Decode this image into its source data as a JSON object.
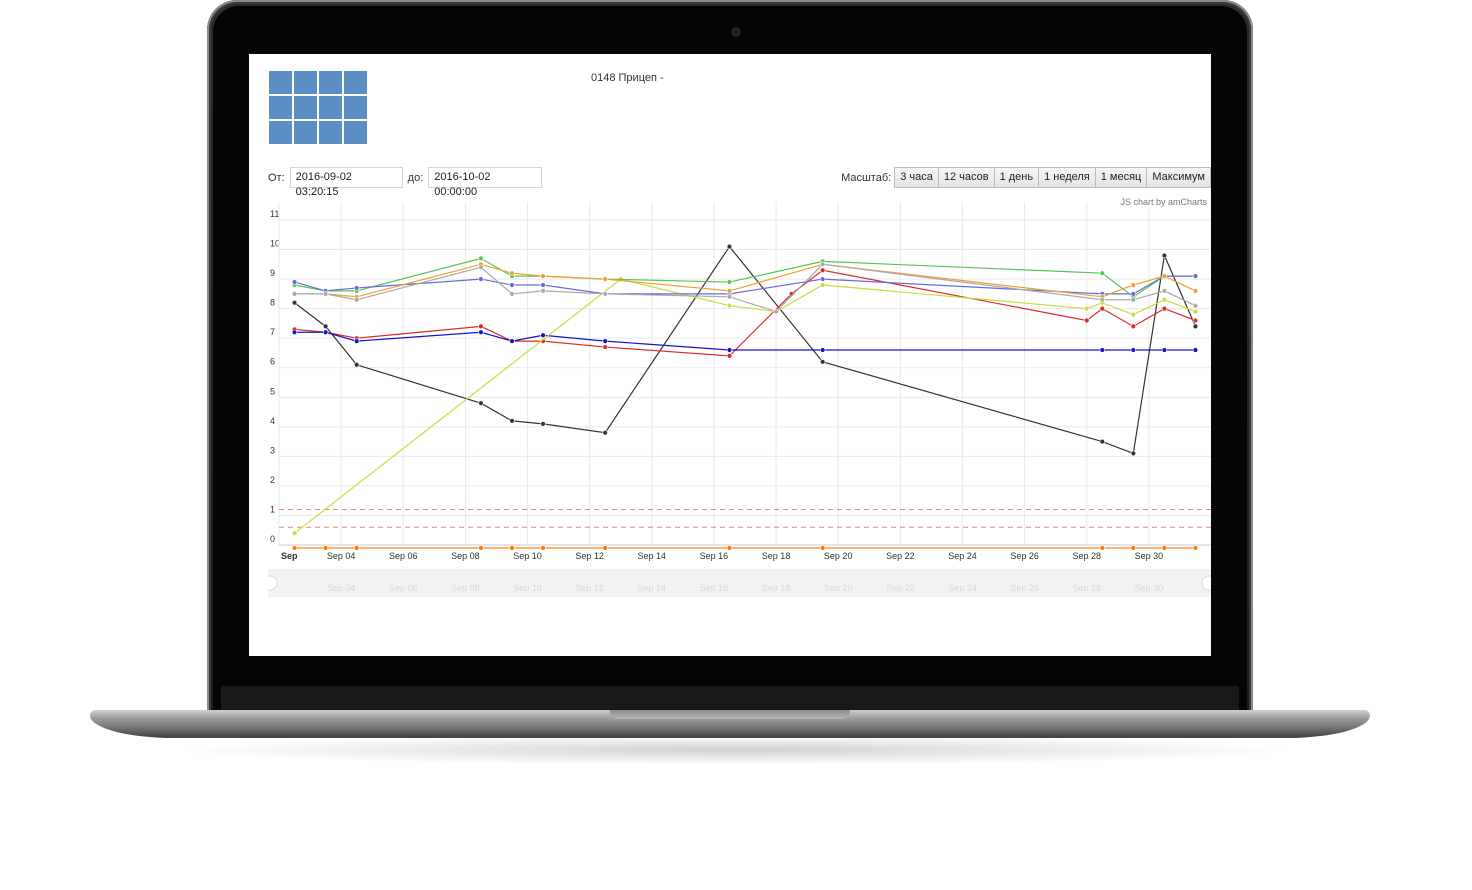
{
  "header": {
    "vehicle_title": "0148 Прицеп -"
  },
  "range": {
    "from_label": "От:",
    "from_value": "2016-09-02 03:20:15",
    "to_label": "до:",
    "to_value": "2016-10-02 00:00:00"
  },
  "scale": {
    "label": "Масштаб:",
    "buttons": [
      "3 часа",
      "12 часов",
      "1 день",
      "1 неделя",
      "1 месяц",
      "Максимум"
    ]
  },
  "credits": "JS chart by amCharts",
  "chart_data": {
    "type": "line",
    "title": "",
    "xlabel": "",
    "ylabel": "",
    "ylim": [
      0,
      11
    ],
    "xlim": [
      "2016-09-02",
      "2016-10-02"
    ],
    "grid": true,
    "legend": "none",
    "x_ticks": [
      "Sep",
      "Sep 04",
      "Sep 06",
      "Sep 08",
      "Sep 10",
      "Sep 12",
      "Sep 14",
      "Sep 16",
      "Sep 18",
      "Sep 20",
      "Sep 22",
      "Sep 24",
      "Sep 26",
      "Sep 28",
      "Sep 30"
    ],
    "y_ticks": [
      0,
      1,
      2,
      3,
      4,
      5,
      6,
      7,
      8,
      9,
      10,
      11
    ],
    "threshold_lines": [
      1.2,
      0.6
    ],
    "threshold_color": "#f08080",
    "scrollbar_labels": [
      "Sep 04",
      "Sep 06",
      "Sep 08",
      "Sep 10",
      "Sep 12",
      "Sep 14",
      "Sep 16",
      "Sep 18",
      "Sep 20",
      "Sep 22",
      "Sep 24",
      "Sep 26",
      "Sep 28",
      "Sep 30"
    ],
    "series": [
      {
        "color": "#333333",
        "x": [
          2.5,
          3.5,
          4.5,
          8.5,
          9.5,
          10.5,
          12.5,
          16.5,
          19.5,
          28.5,
          29.5,
          30.5,
          31.5
        ],
        "values": [
          8.2,
          7.4,
          6.1,
          4.8,
          4.2,
          4.1,
          3.8,
          10.1,
          6.2,
          3.5,
          3.1,
          9.8,
          7.4
        ]
      },
      {
        "color": "#dc2a2a",
        "x": [
          2.5,
          3.5,
          4.5,
          8.5,
          9.5,
          10.5,
          12.5,
          16.5,
          18.5,
          19.5,
          28,
          28.5,
          29.5,
          30.5,
          31.5
        ],
        "values": [
          7.3,
          7.2,
          7.0,
          7.4,
          6.9,
          6.9,
          6.7,
          6.4,
          8.5,
          9.3,
          7.6,
          8.0,
          7.4,
          8.0,
          7.6
        ]
      },
      {
        "color": "#1414c8",
        "x": [
          2.5,
          3.5,
          4.5,
          8.5,
          9.5,
          10.5,
          12.5,
          16.5,
          19.5,
          28.5,
          29.5,
          30.5,
          31.5
        ],
        "values": [
          7.2,
          7.2,
          6.9,
          7.2,
          6.9,
          7.1,
          6.9,
          6.6,
          6.6,
          6.6,
          6.6,
          6.6,
          6.6
        ]
      },
      {
        "color": "#c8dc3c",
        "x": [
          2.5,
          13,
          16.5,
          18,
          19.5,
          28,
          28.5,
          29.5,
          30.5,
          31.5
        ],
        "values": [
          0.4,
          9.0,
          8.1,
          7.9,
          8.8,
          8.0,
          8.2,
          7.8,
          8.3,
          7.9
        ]
      },
      {
        "color": "#50c850",
        "x": [
          2.5,
          3.5,
          4.5,
          8.5,
          9.5,
          10.5,
          12.5,
          16.5,
          19.5,
          28.5,
          29.5,
          30.5,
          31.5
        ],
        "values": [
          8.8,
          8.6,
          8.6,
          9.7,
          9.1,
          9.1,
          9.0,
          8.9,
          9.6,
          9.2,
          8.4,
          9.1,
          9.1
        ]
      },
      {
        "color": "#6a6ad8",
        "x": [
          2.5,
          3.5,
          4.5,
          8.5,
          9.5,
          10.5,
          12.5,
          16.5,
          19.5,
          28.5,
          29.5,
          30.5,
          31.5
        ],
        "values": [
          8.9,
          8.6,
          8.7,
          9.0,
          8.8,
          8.8,
          8.5,
          8.5,
          9.0,
          8.5,
          8.5,
          9.1,
          9.1
        ]
      },
      {
        "color": "#f0a030",
        "x": [
          2.5,
          3.5,
          4.5,
          8.5,
          9.5,
          10.5,
          12.5,
          16.5,
          19.5,
          28.5,
          29.5,
          30.5,
          31.5
        ],
        "values": [
          8.5,
          8.5,
          8.4,
          9.5,
          9.2,
          9.1,
          9.0,
          8.6,
          9.5,
          8.4,
          8.8,
          9.1,
          8.6
        ]
      },
      {
        "color": "#aaaaaa",
        "x": [
          2.5,
          3.5,
          4.5,
          8.5,
          9.5,
          10.5,
          12.5,
          16.5,
          18,
          19.5,
          28.5,
          29.5,
          30.5,
          31.5
        ],
        "values": [
          8.5,
          8.5,
          8.3,
          9.4,
          8.5,
          8.6,
          8.5,
          8.4,
          7.9,
          9.5,
          8.3,
          8.3,
          8.6,
          8.1
        ]
      },
      {
        "color": "#ff7a00",
        "x": [
          2.5,
          3.5,
          4.5,
          8.5,
          9.5,
          10.5,
          12.5,
          16.5,
          19.5,
          28.5,
          29.5,
          30.5,
          31.5
        ],
        "values": [
          -0.1,
          -0.1,
          -0.1,
          -0.1,
          -0.1,
          -0.1,
          -0.1,
          -0.1,
          -0.1,
          -0.1,
          -0.1,
          -0.1,
          -0.1
        ]
      }
    ]
  }
}
